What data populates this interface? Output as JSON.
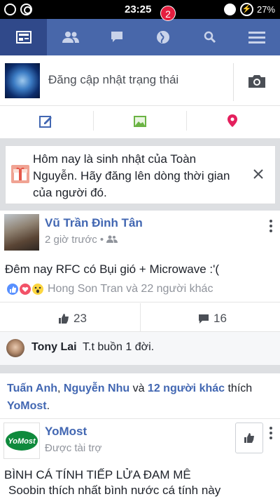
{
  "status_bar": {
    "time": "23:25",
    "battery": "27%"
  },
  "nav": {
    "notification_count": "2"
  },
  "composer": {
    "placeholder": "Đăng cập nhật trạng thái"
  },
  "birthday": {
    "text": "Hôm nay là sinh nhật của Toàn Nguyễn. Hãy đăng lên dòng thời gian của người đó."
  },
  "post1": {
    "author": "Vũ Trần Đình Tân",
    "time": "2 giờ trước",
    "text": "Đêm nay RFC có Bụi gió + Microwave :'(",
    "reactors": "Hong Son Tran và 22 người khác",
    "like_count": "23",
    "comment_count": "16",
    "comment": {
      "author": "Tony Lai",
      "text": "T.t buồn 1 đời."
    }
  },
  "post2": {
    "likers": {
      "name1": "Tuấn Anh",
      "sep": ",",
      "name2": "Nguyễn Nhu",
      "and": "và",
      "others": "12 người khác",
      "verb": "thích",
      "page": "YoMost",
      "end": "."
    },
    "author": "YoMost",
    "logo_text": "YoMost",
    "sponsored": "Được tài trợ",
    "line1": "BÌNH CÁ TÍNH TIẾP LỬA ĐAM MÊ",
    "line2": "Soobin thích nhất bình nước cá tính này"
  },
  "colors": {
    "brand": "#4867aa",
    "link": "#4267b2",
    "badge": "#e41e3f"
  }
}
